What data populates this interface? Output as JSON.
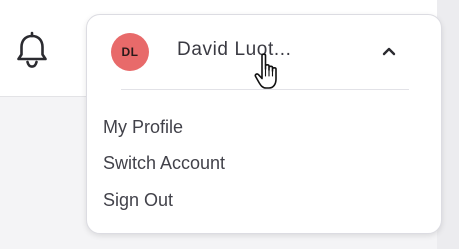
{
  "header": {
    "notifications_icon": "bell-icon"
  },
  "user_menu": {
    "avatar_initials": "DL",
    "avatar_color": "#e86a6a",
    "user_name": "David Luot...",
    "toggle_icon": "chevron-up-icon",
    "items": [
      {
        "label": "My Profile"
      },
      {
        "label": "Switch Account"
      },
      {
        "label": "Sign Out"
      }
    ]
  },
  "pointer": {
    "icon": "hand-pointer-cursor-icon"
  }
}
